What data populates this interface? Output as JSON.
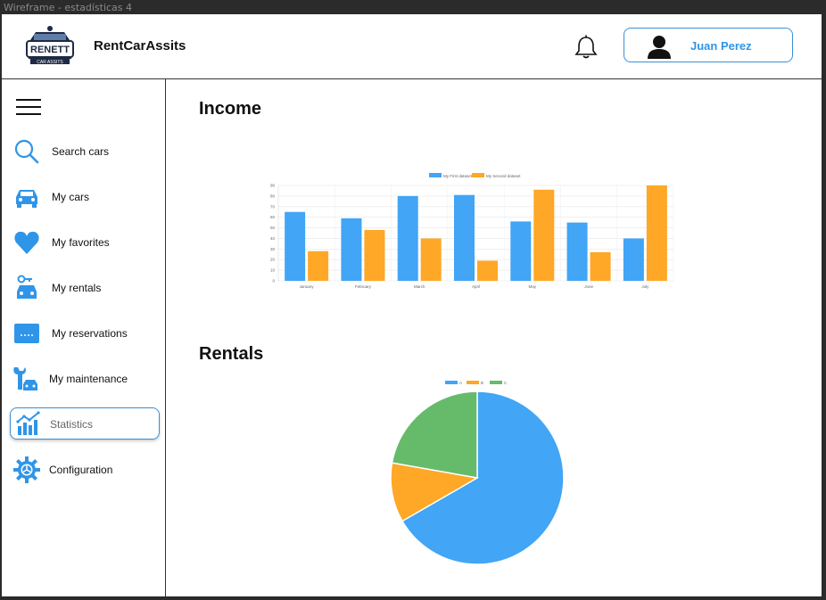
{
  "window_title": "Wireframe - estadísticas 4",
  "header": {
    "brand": "RentCarAssits",
    "logo_text": "RENETT CAR ASSITS",
    "user_name": "Juan Perez"
  },
  "sidebar": {
    "items": [
      {
        "label": "Search cars",
        "icon": "search-icon"
      },
      {
        "label": "My cars",
        "icon": "car-icon"
      },
      {
        "label": "My favorites",
        "icon": "heart-icon"
      },
      {
        "label": "My rentals",
        "icon": "key-car-icon"
      },
      {
        "label": "My reservations",
        "icon": "reservation-icon"
      },
      {
        "label": "My maintenance",
        "icon": "wrench-car-icon"
      },
      {
        "label": "Statistics",
        "icon": "chart-icon",
        "active": true
      },
      {
        "label": "Configuration",
        "icon": "gear-icon"
      }
    ]
  },
  "main": {
    "income_title": "Income",
    "rentals_title": "Rentals"
  },
  "colors": {
    "blue": "#42a5f5",
    "orange": "#ffa726",
    "green": "#66bb6a",
    "accent": "#2f95e8"
  },
  "chart_data": [
    {
      "type": "bar",
      "categories": [
        "January",
        "February",
        "March",
        "April",
        "May",
        "June",
        "July"
      ],
      "series": [
        {
          "name": "My First dataset",
          "values": [
            65,
            59,
            80,
            81,
            56,
            55,
            40
          ]
        },
        {
          "name": "My Second dataset",
          "values": [
            28,
            48,
            40,
            19,
            86,
            27,
            90
          ]
        }
      ],
      "ylim": [
        0,
        90
      ],
      "yticks": [
        0,
        10,
        20,
        30,
        40,
        50,
        60,
        70,
        80,
        90
      ],
      "legend": "top",
      "grid": true
    },
    {
      "type": "pie",
      "labels": [
        "A",
        "B",
        "C"
      ],
      "values": [
        300,
        50,
        100
      ],
      "legend": "top"
    }
  ]
}
